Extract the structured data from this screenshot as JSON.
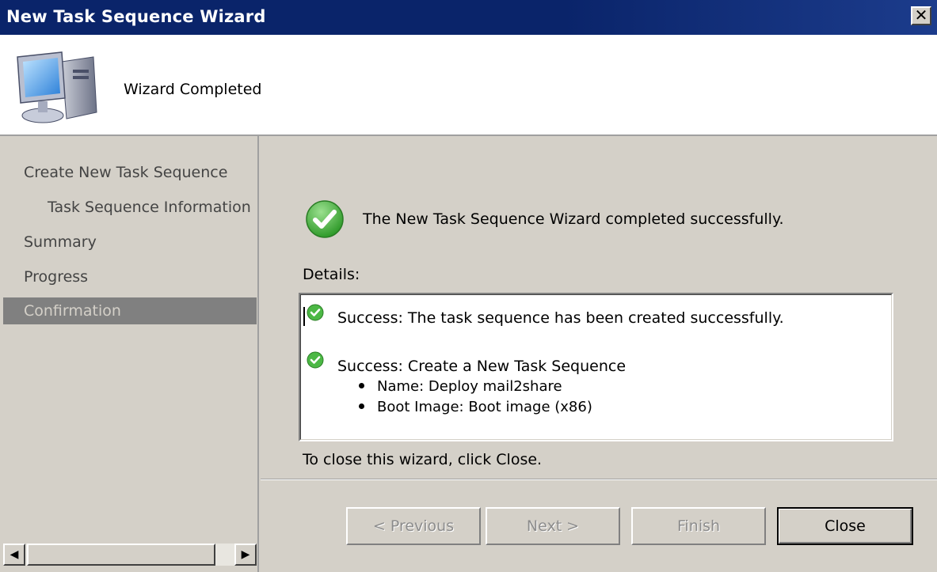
{
  "window": {
    "title": "New Task Sequence Wizard",
    "close_glyph": "✕"
  },
  "header": {
    "icon": "computer-icon",
    "title": "Wizard Completed"
  },
  "nav": {
    "items": [
      {
        "label": "Create New Task Sequence",
        "indent": 0,
        "selected": false
      },
      {
        "label": "Task Sequence Information",
        "indent": 1,
        "selected": false
      },
      {
        "label": "Summary",
        "indent": 0,
        "selected": false
      },
      {
        "label": "Progress",
        "indent": 0,
        "selected": false
      },
      {
        "label": "Confirmation",
        "indent": 0,
        "selected": true
      }
    ],
    "scroll_left_glyph": "◀",
    "scroll_right_glyph": "▶"
  },
  "main": {
    "status_icon": "success-check-icon",
    "message": "The New Task Sequence Wizard completed successfully.",
    "details_label": "Details:",
    "details": [
      {
        "text": "Success: The task sequence has been created successfully.",
        "bullets": []
      },
      {
        "text": "Success: Create a New Task Sequence",
        "bullets": [
          "Name: Deploy mail2share",
          "Boot Image: Boot image (x86)"
        ]
      }
    ],
    "close_hint": "To close this wizard, click Close."
  },
  "buttons": {
    "previous": "< Previous",
    "next": "Next >",
    "finish": "Finish",
    "close": "Close"
  },
  "colors": {
    "title_bar": "#0a246a",
    "selected_nav": "#808080",
    "success_green": "#3ca535"
  }
}
